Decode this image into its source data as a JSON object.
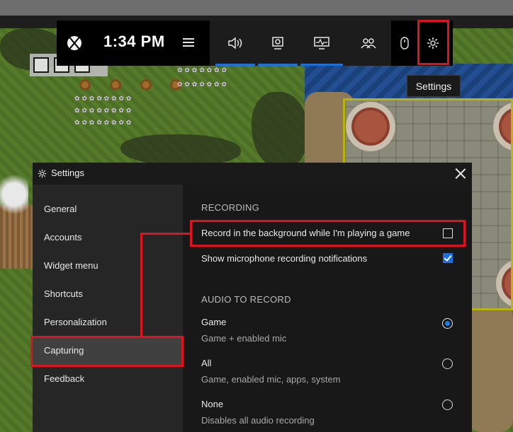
{
  "game_bar": {
    "time": "1:34 PM",
    "widgets": [
      {
        "name": "audio",
        "icon": "speaker-icon",
        "active": true
      },
      {
        "name": "capture",
        "icon": "capture-icon",
        "active": true
      },
      {
        "name": "performance",
        "icon": "performance-icon",
        "active": true
      },
      {
        "name": "xbox-social",
        "icon": "people-icon",
        "active": false
      }
    ],
    "tooltip": "Settings"
  },
  "settings": {
    "title": "Settings",
    "nav": [
      {
        "label": "General"
      },
      {
        "label": "Accounts"
      },
      {
        "label": "Widget menu"
      },
      {
        "label": "Shortcuts"
      },
      {
        "label": "Personalization"
      },
      {
        "label": "Capturing",
        "selected": true
      },
      {
        "label": "Feedback"
      }
    ],
    "recording": {
      "heading": "RECORDING",
      "background_label": "Record in the background while I'm playing a game",
      "background_checked": false,
      "mic_notify_label": "Show microphone recording notifications",
      "mic_notify_checked": true
    },
    "audio": {
      "heading": "AUDIO TO RECORD",
      "options": [
        {
          "label": "Game",
          "sub": "Game + enabled mic",
          "selected": true
        },
        {
          "label": "All",
          "sub": "Game, enabled mic, apps, system",
          "selected": false
        },
        {
          "label": "None",
          "sub": "Disables all audio recording",
          "selected": false
        }
      ]
    }
  },
  "colors": {
    "accent": "#1e6fd9",
    "highlight": "#e0121f"
  }
}
